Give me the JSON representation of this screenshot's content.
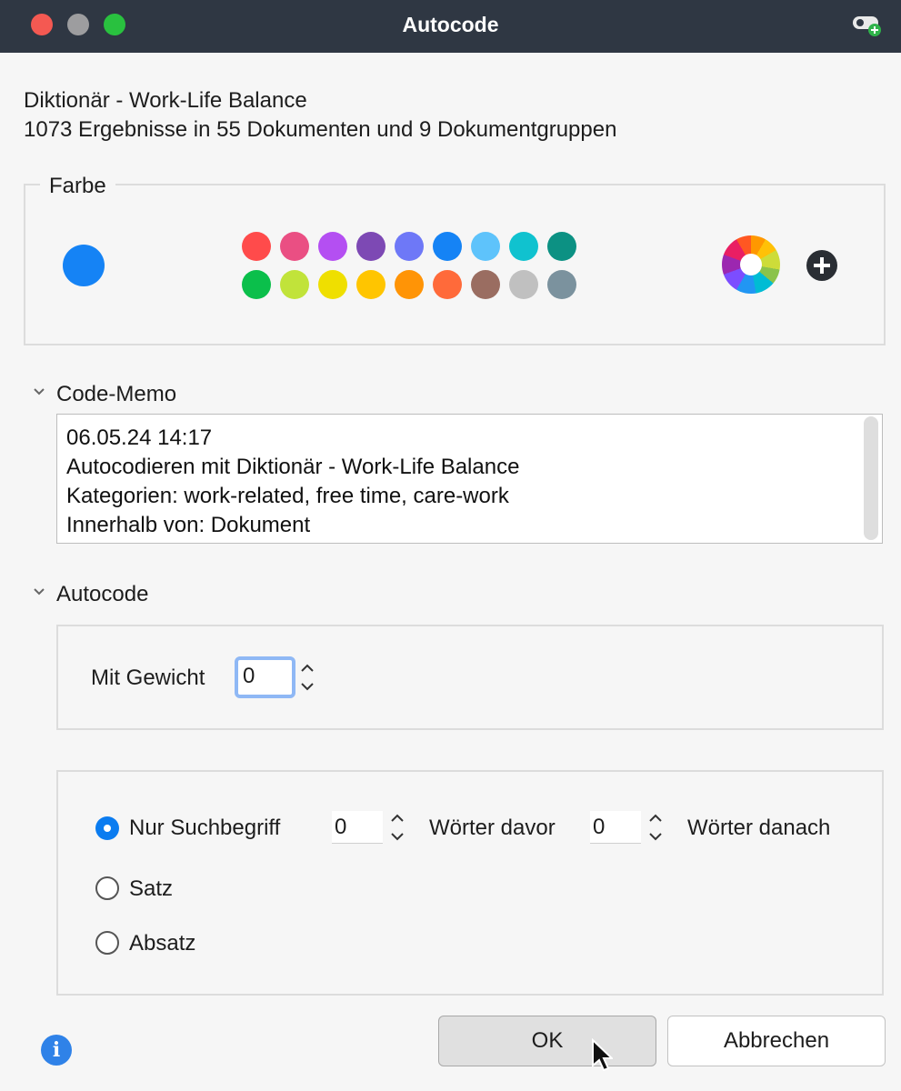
{
  "window": {
    "title": "Autocode"
  },
  "header": {
    "line1": "Diktionär - Work-Life Balance",
    "line2": "1073 Ergebnisse in 55 Dokumenten und 9 Dokumentgruppen"
  },
  "farbe": {
    "legend": "Farbe",
    "current_color": "#1583f5",
    "swatches_row1": [
      "#ff4b4b",
      "#ea4f83",
      "#b44ff2",
      "#7d49b4",
      "#6e78f7",
      "#1583f5",
      "#5ec3fb",
      "#10c2cf",
      "#0c9183"
    ],
    "swatches_row2": [
      "#0bbf4b",
      "#c1e33a",
      "#efdf00",
      "#ffc500",
      "#ff9406",
      "#ff6a3a",
      "#9a6d61",
      "#c0c0c0",
      "#7b929e"
    ]
  },
  "memo": {
    "heading": "Code-Memo",
    "lines": [
      "06.05.24 14:17",
      "Autocodieren mit Diktionär - Work-Life Balance",
      "Kategorien: work-related, free time, care-work",
      "Innerhalb von: Dokument"
    ]
  },
  "autocode": {
    "heading": "Autocode",
    "weight_label": "Mit Gewicht",
    "weight_value": "0",
    "scope": {
      "option1": "Nur Suchbegriff",
      "option2": "Satz",
      "option3": "Absatz",
      "selected": "Nur Suchbegriff",
      "words_before_value": "0",
      "words_before_label": "Wörter davor",
      "words_after_value": "0",
      "words_after_label": "Wörter danach"
    }
  },
  "buttons": {
    "ok": "OK",
    "cancel": "Abbrechen"
  },
  "icons": {
    "info": "i"
  }
}
